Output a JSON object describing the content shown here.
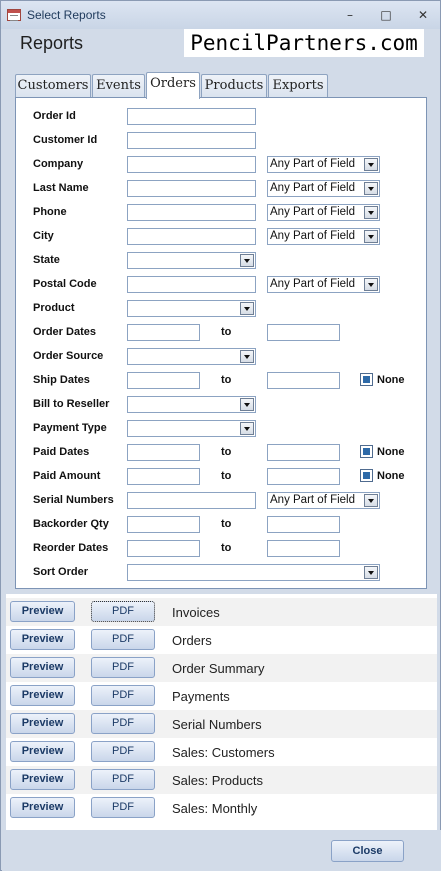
{
  "window": {
    "title": "Select Reports"
  },
  "header": {
    "title": "Reports",
    "logo_text": "PencilPartners.com"
  },
  "tabs": [
    {
      "label": "Customers"
    },
    {
      "label": "Events"
    },
    {
      "label": "Orders",
      "active": true
    },
    {
      "label": "Products"
    },
    {
      "label": "Exports"
    }
  ],
  "form": {
    "order_id": {
      "label": "Order Id",
      "value": ""
    },
    "customer_id": {
      "label": "Customer Id",
      "value": ""
    },
    "company": {
      "label": "Company",
      "value": "",
      "match": "Any Part of Field"
    },
    "last_name": {
      "label": "Last Name",
      "value": "",
      "match": "Any Part of Field"
    },
    "phone": {
      "label": "Phone",
      "value": "",
      "match": "Any Part of Field"
    },
    "city": {
      "label": "City",
      "value": "",
      "match": "Any Part of Field"
    },
    "state": {
      "label": "State",
      "value": ""
    },
    "postal_code": {
      "label": "Postal Code",
      "value": "",
      "match": "Any Part of Field"
    },
    "product": {
      "label": "Product",
      "value": ""
    },
    "order_dates": {
      "label": "Order Dates",
      "to": "to",
      "from_value": "",
      "to_value": ""
    },
    "order_source": {
      "label": "Order Source",
      "value": ""
    },
    "ship_dates": {
      "label": "Ship Dates",
      "to": "to",
      "from_value": "",
      "to_value": "",
      "none_label": "None",
      "none_checked": true
    },
    "bill_to_reseller": {
      "label": "Bill to Reseller",
      "value": ""
    },
    "payment_type": {
      "label": "Payment Type",
      "value": ""
    },
    "paid_dates": {
      "label": "Paid Dates",
      "to": "to",
      "from_value": "",
      "to_value": "",
      "none_label": "None",
      "none_checked": true
    },
    "paid_amount": {
      "label": "Paid Amount",
      "to": "to",
      "from_value": "",
      "to_value": "",
      "none_label": "None",
      "none_checked": true
    },
    "serial_numbers": {
      "label": "Serial Numbers",
      "value": "",
      "match": "Any Part of Field"
    },
    "backorder_qty": {
      "label": "Backorder Qty",
      "to": "to",
      "from_value": "",
      "to_value": ""
    },
    "reorder_dates": {
      "label": "Reorder Dates",
      "to": "to",
      "from_value": "",
      "to_value": ""
    },
    "sort_order": {
      "label": "Sort Order",
      "value": ""
    }
  },
  "reports": {
    "preview_label": "Preview",
    "pdf_label": "PDF",
    "items": [
      {
        "name": "Invoices"
      },
      {
        "name": "Orders"
      },
      {
        "name": "Order Summary"
      },
      {
        "name": "Payments"
      },
      {
        "name": "Serial Numbers"
      },
      {
        "name": "Sales: Customers"
      },
      {
        "name": "Sales: Products"
      },
      {
        "name": "Sales: Monthly"
      }
    ]
  },
  "footer": {
    "close_label": "Close"
  },
  "colors": {
    "window_bg": "#d2dbe8",
    "border": "#7d94b5",
    "button_text": "#1b3a66",
    "checkbox_fill": "#2e6aa8"
  }
}
